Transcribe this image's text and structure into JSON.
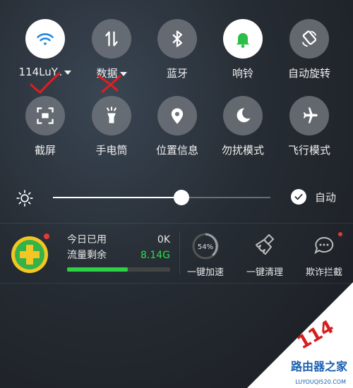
{
  "toggles_row1": [
    {
      "label": "114LuY..",
      "icon": "wifi-icon",
      "on": true,
      "dropdown": true
    },
    {
      "label": "数据",
      "icon": "mobile-data-icon",
      "on": false,
      "dropdown": true
    },
    {
      "label": "蓝牙",
      "icon": "bluetooth-icon",
      "on": false,
      "dropdown": false
    },
    {
      "label": "响铃",
      "icon": "bell-icon",
      "on": true,
      "dropdown": false
    },
    {
      "label": "自动旋转",
      "icon": "auto-rotate-icon",
      "on": false,
      "dropdown": false
    }
  ],
  "toggles_row2": [
    {
      "label": "截屏",
      "icon": "screenshot-icon"
    },
    {
      "label": "手电筒",
      "icon": "flashlight-icon"
    },
    {
      "label": "位置信息",
      "icon": "location-icon"
    },
    {
      "label": "勿扰模式",
      "icon": "moon-icon"
    },
    {
      "label": "飞行模式",
      "icon": "airplane-icon"
    }
  ],
  "brightness": {
    "level": 0.59,
    "auto_label": "自动",
    "auto_checked": true
  },
  "data_widget": {
    "used_label": "今日已用",
    "used_value": "0K",
    "remaining_label": "流量剩余",
    "remaining_value": "8.14G",
    "usage_fraction": 0.59
  },
  "actions": [
    {
      "label": "一键加速",
      "icon": "speed-gauge-icon",
      "badge": "54%"
    },
    {
      "label": "一键清理",
      "icon": "broom-icon"
    },
    {
      "label": "欺诈拦截",
      "icon": "fraud-block-icon"
    }
  ],
  "watermark": {
    "number": "114",
    "title": "路由器之家",
    "url": "LUYOUQI520.COM"
  },
  "colors": {
    "accent_green": "#2ad244",
    "wifi_blue": "#1e88e5",
    "bell_green": "#2bbf4a",
    "badge_red": "#e53935"
  }
}
